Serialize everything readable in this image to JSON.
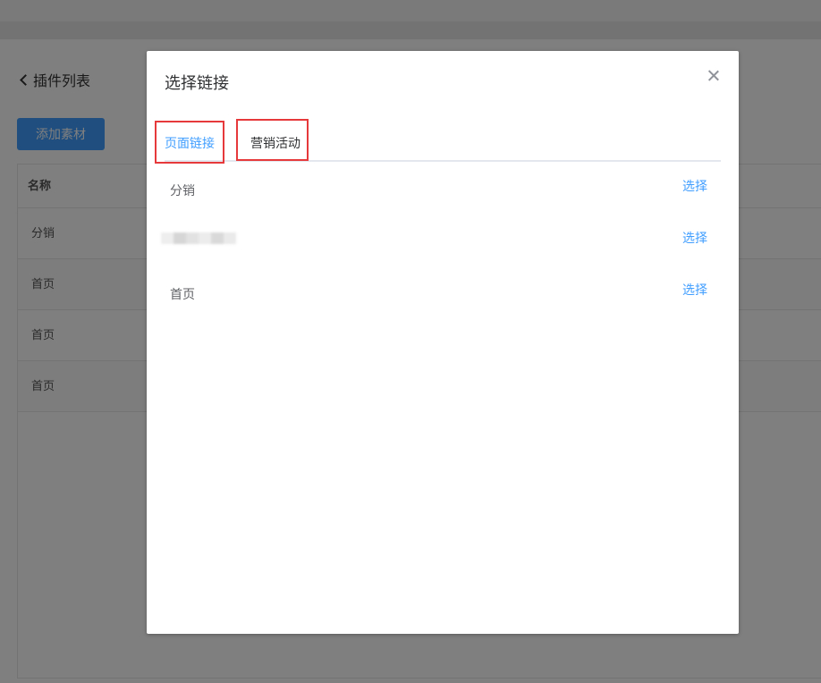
{
  "background": {
    "back_label": "插件列表",
    "add_button": "添加素材",
    "table": {
      "header": "名称",
      "rows": [
        "分销",
        "首页",
        "首页",
        "首页"
      ]
    }
  },
  "dialog": {
    "title": "选择链接",
    "tabs": [
      {
        "label": "页面链接",
        "active": true
      },
      {
        "label": "营销活动",
        "active": false
      }
    ],
    "items": [
      {
        "name": "分销",
        "action": "选择"
      },
      {
        "name": "",
        "action": "选择",
        "redacted": true
      },
      {
        "name": "首页",
        "action": "选择"
      }
    ]
  },
  "colors": {
    "primary": "#409eff",
    "highlight": "#e5393b"
  }
}
